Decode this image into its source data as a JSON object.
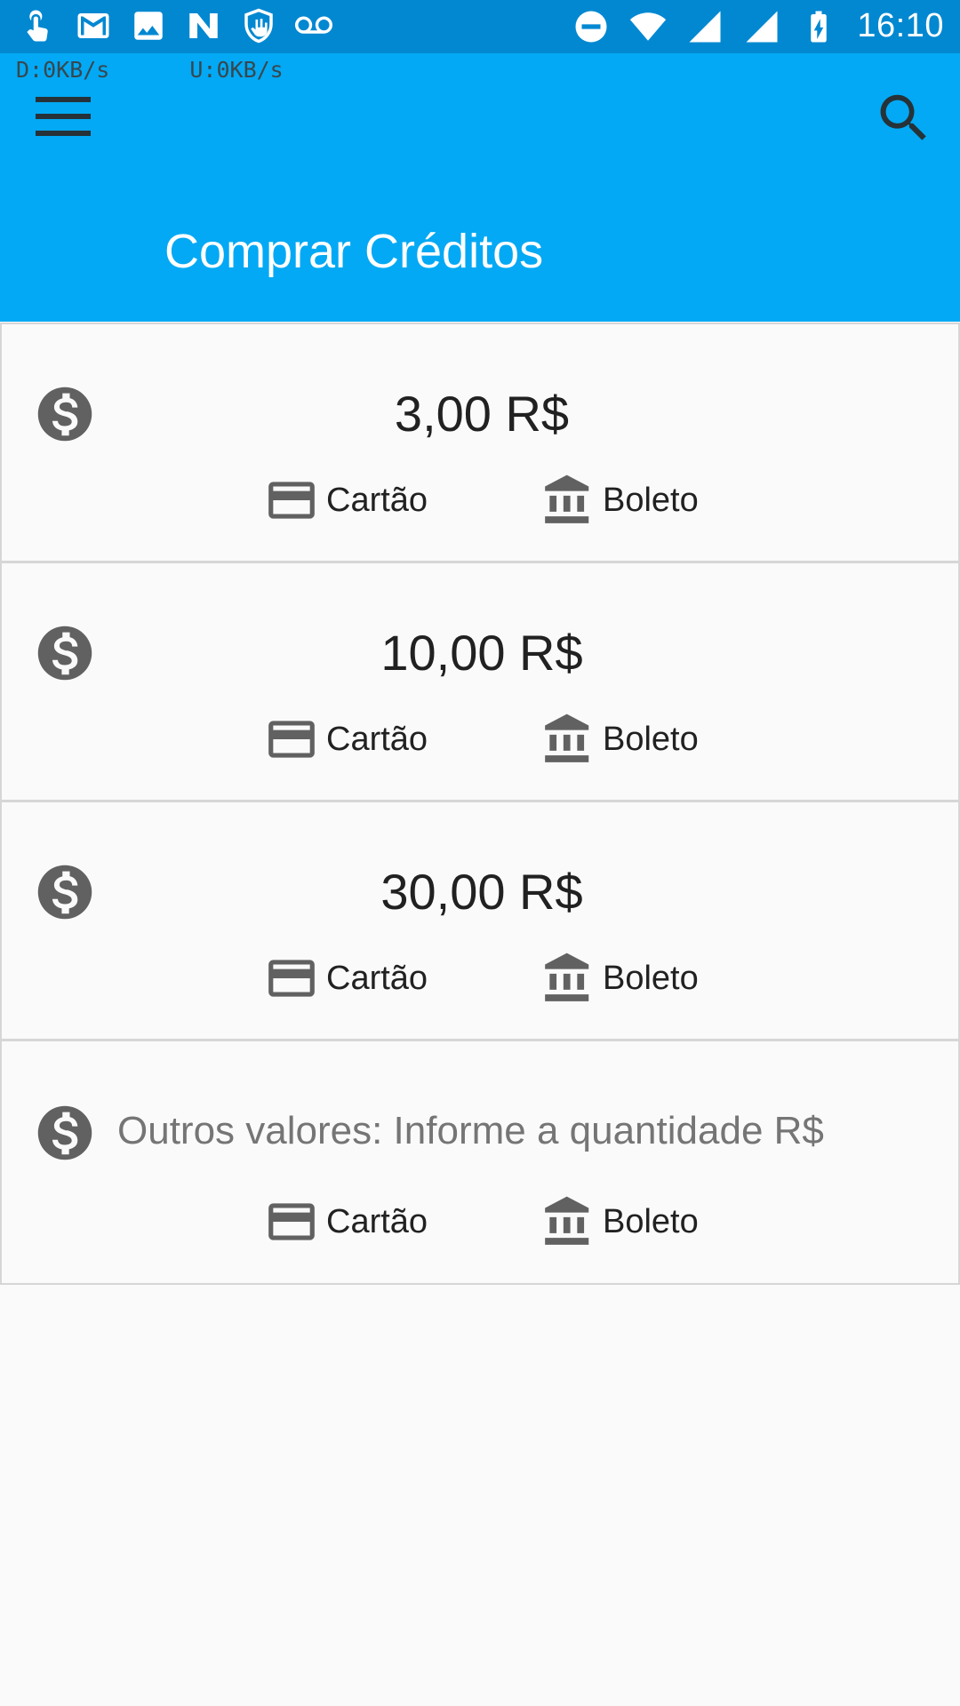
{
  "status_bar": {
    "time": "16:10",
    "left_icons": [
      "touch-icon",
      "gmail-icon",
      "image-icon",
      "n-icon",
      "hand-shield-icon",
      "voicemail-icon"
    ],
    "right_icons": [
      "do-not-disturb-icon",
      "wifi-icon",
      "signal-icon",
      "signal-icon",
      "battery-charging-icon"
    ]
  },
  "net_speed": {
    "down": "D:0KB/s",
    "up": "U:0KB/s"
  },
  "app_bar": {
    "title": "Comprar Créditos",
    "background": "#03a9f4",
    "menu_icon": "menu-icon",
    "search_icon": "search-icon"
  },
  "options": [
    {
      "amount": "3,00 R$",
      "card_label": "Cartão",
      "boleto_label": "Boleto"
    },
    {
      "amount": "10,00 R$",
      "card_label": "Cartão",
      "boleto_label": "Boleto"
    },
    {
      "amount": "30,00 R$",
      "card_label": "Cartão",
      "boleto_label": "Boleto"
    }
  ],
  "other": {
    "placeholder": "Outros valores: Informe a quantidade R$",
    "card_label": "Cartão",
    "boleto_label": "Boleto"
  }
}
